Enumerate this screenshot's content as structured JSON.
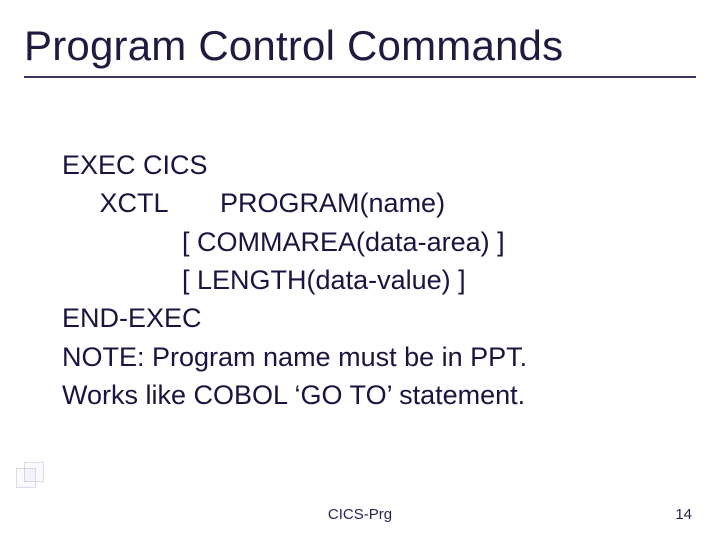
{
  "title": "Program Control Commands",
  "code": {
    "l1": "EXEC CICS",
    "l2": "     XCTL       PROGRAM(name)",
    "l3": "                [ COMMAREA(data-area) ]",
    "l4": "                [ LENGTH(data-value) ]",
    "l5": "END-EXEC",
    "l6": "NOTE: Program name must be in PPT.",
    "l7": "Works like COBOL ‘GO TO’ statement."
  },
  "footer": {
    "center": "CICS-Prg",
    "page": "14"
  }
}
